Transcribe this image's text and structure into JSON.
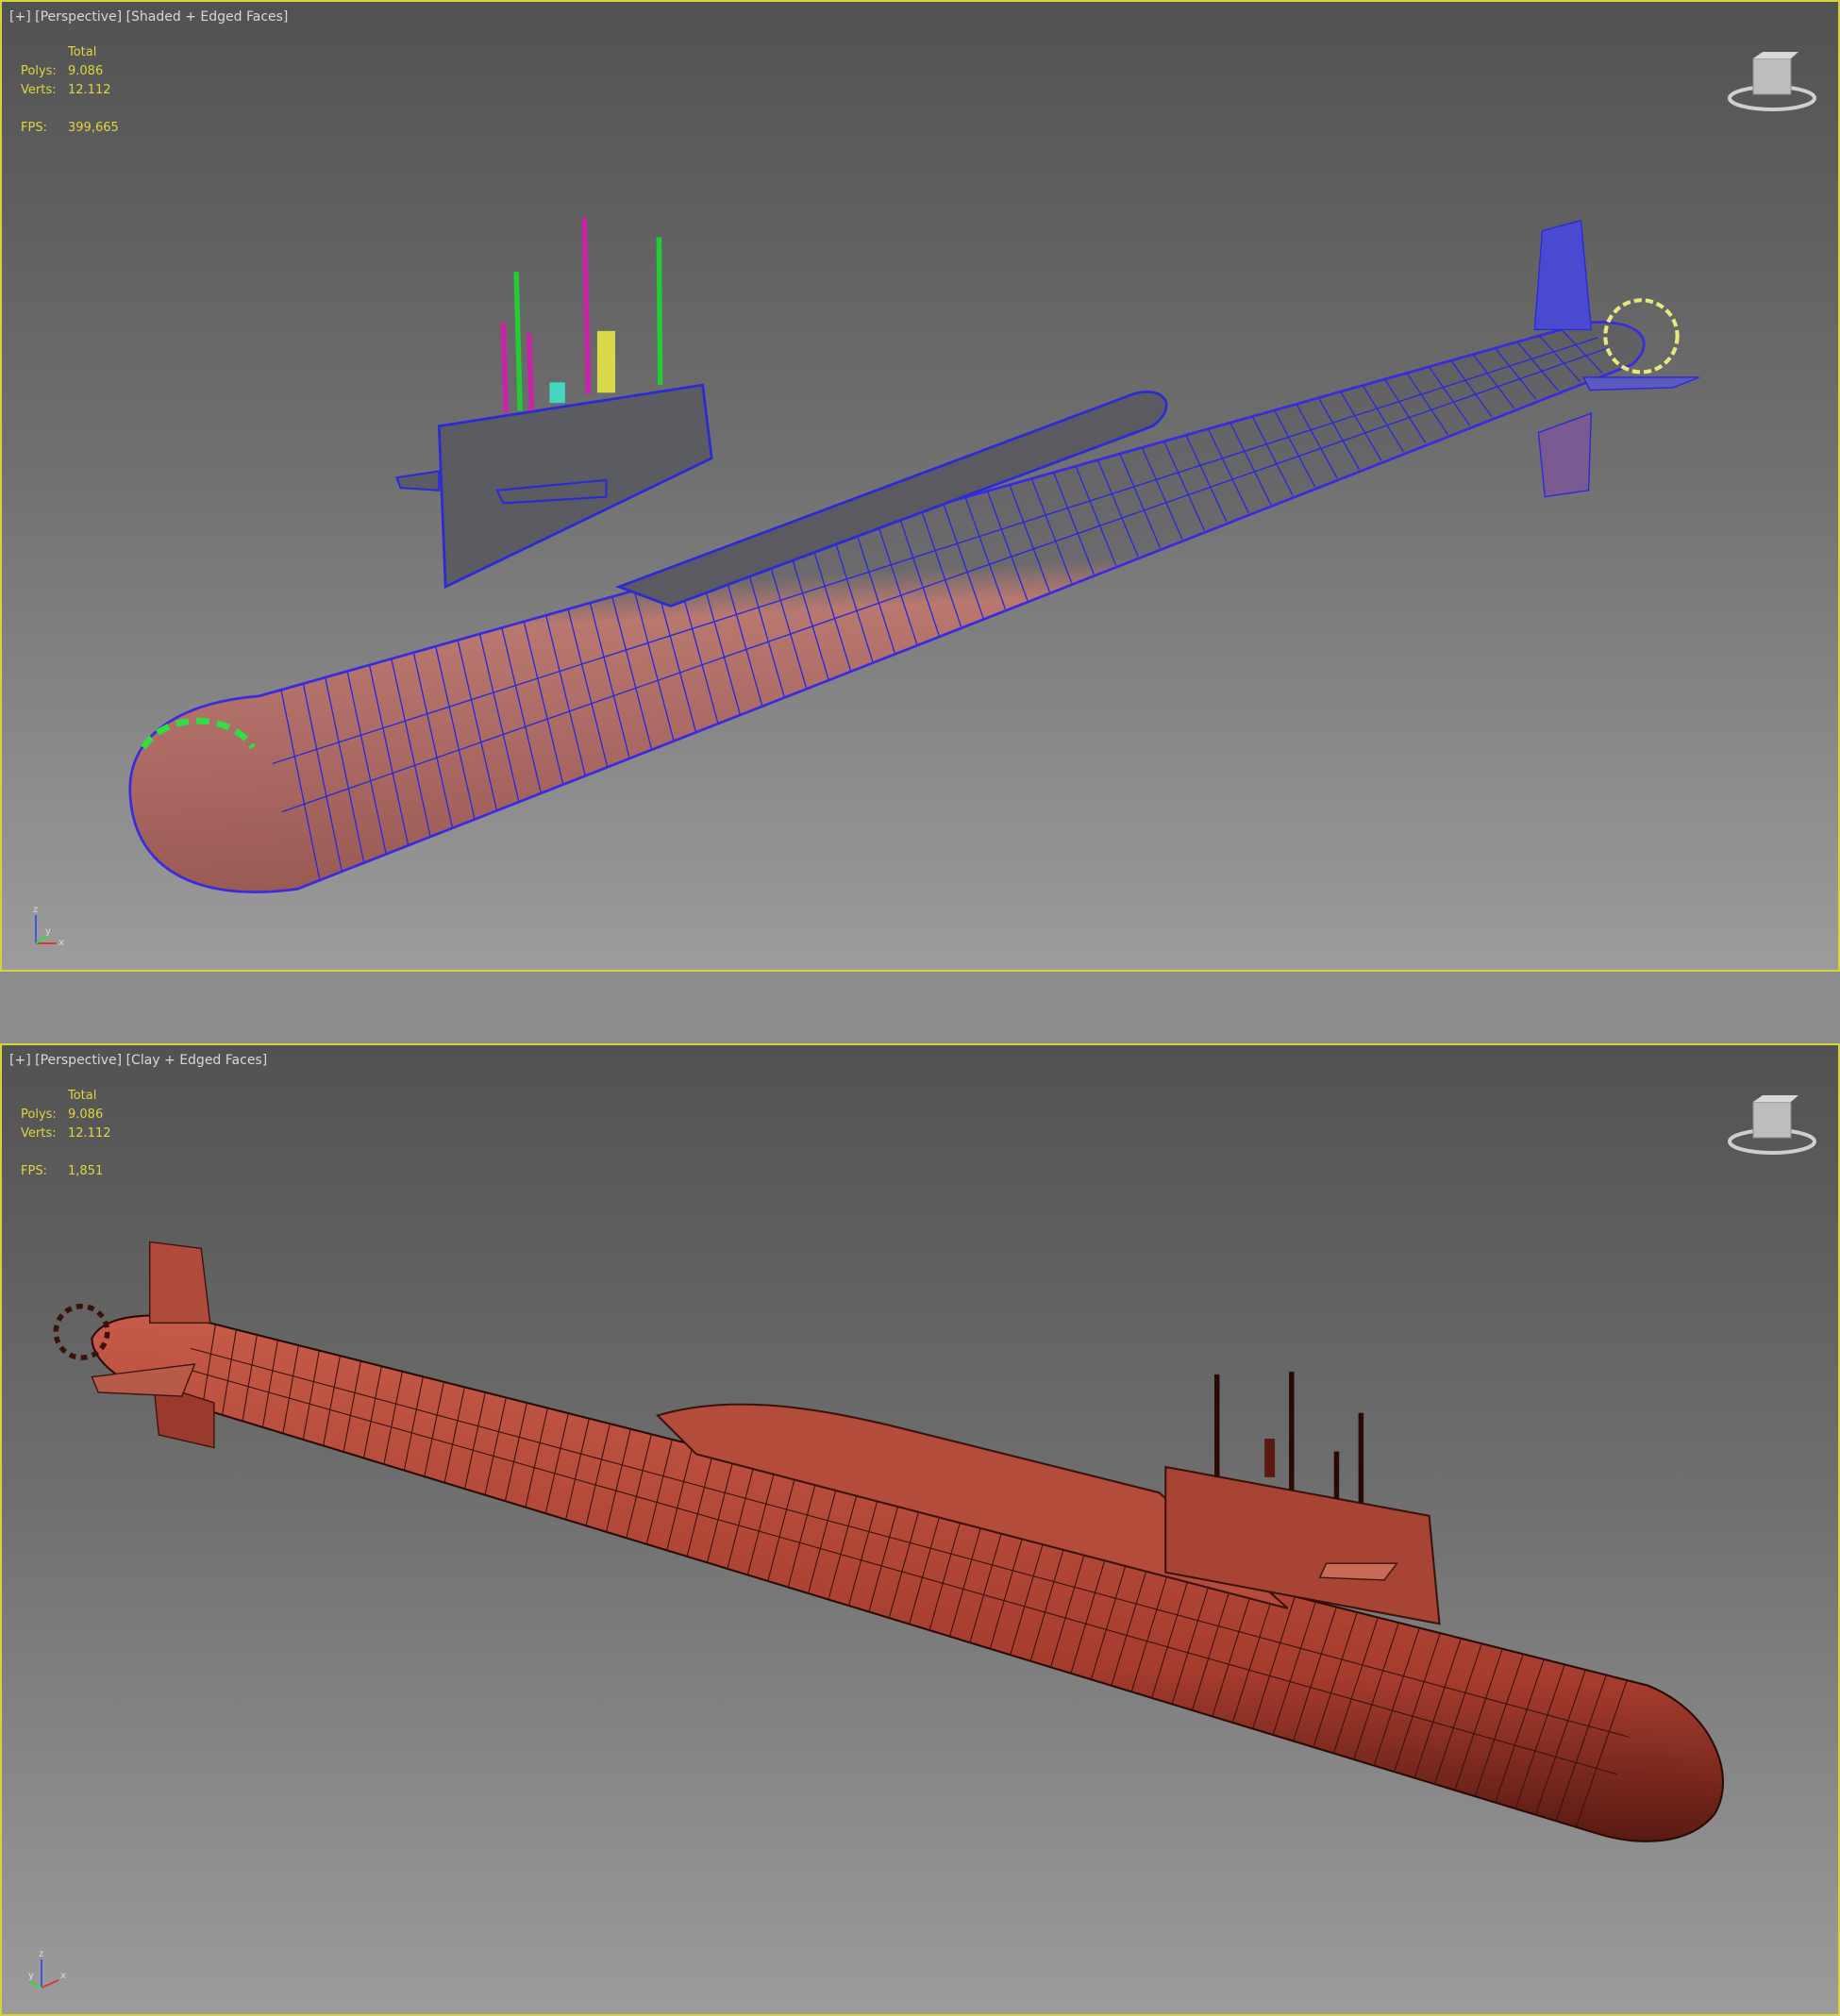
{
  "viewports": [
    {
      "label_plus": "[+]",
      "label_view": "[Perspective]",
      "label_mode": "[Shaded + Edged Faces]",
      "stats": {
        "total_label": "Total",
        "polys_label": "Polys:",
        "polys": "9.086",
        "verts_label": "Verts:",
        "verts": "12.112",
        "fps_label": "FPS:",
        "fps": "399,665"
      }
    },
    {
      "label_plus": "[+]",
      "label_view": "[Perspective]",
      "label_mode": "[Clay + Edged Faces]",
      "stats": {
        "total_label": "Total",
        "polys_label": "Polys:",
        "polys": "9.086",
        "verts_label": "Verts:",
        "verts": "12.112",
        "fps_label": "FPS:",
        "fps": "1,851"
      }
    }
  ],
  "gizmo": {
    "z": "z",
    "y": "y",
    "x": "x"
  },
  "colors": {
    "border": "#d6d23a",
    "wire_top": "#2a2ad8",
    "clay": "#b2473a",
    "hull_pink": "#c07b72"
  }
}
